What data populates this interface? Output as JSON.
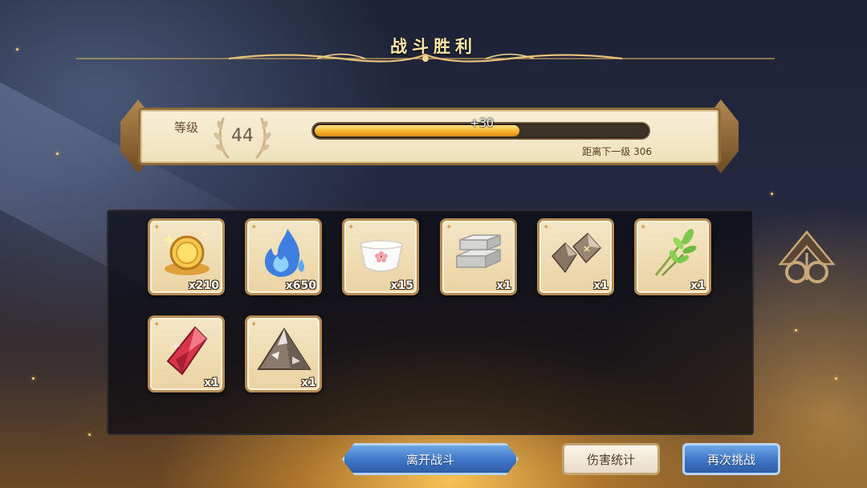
{
  "header": {
    "title": "战斗胜利"
  },
  "level": {
    "label": "等级",
    "value": "44",
    "xp_gain": "+30",
    "xp_progress": 0.62,
    "next_level_text": "距离下一级 306"
  },
  "rewards": [
    {
      "item": "gold-coin",
      "qty": "x210"
    },
    {
      "item": "blue-flame",
      "qty": "x650"
    },
    {
      "item": "sakura-cup",
      "qty": "x15"
    },
    {
      "item": "stone-bricks",
      "qty": "x1"
    },
    {
      "item": "crystal-chunks",
      "qty": "x1"
    },
    {
      "item": "green-herb",
      "qty": "x1"
    },
    {
      "item": "red-gem",
      "qty": "x1"
    },
    {
      "item": "ore-pile",
      "qty": "x1"
    }
  ],
  "buttons": {
    "leave": "离开战斗",
    "damage_stats": "伤害统计",
    "retry": "再次挑战"
  },
  "colors": {
    "accent_gold": "#f6b42e",
    "button_blue": "#3d74c4",
    "slot_frame": "#b58c55"
  }
}
